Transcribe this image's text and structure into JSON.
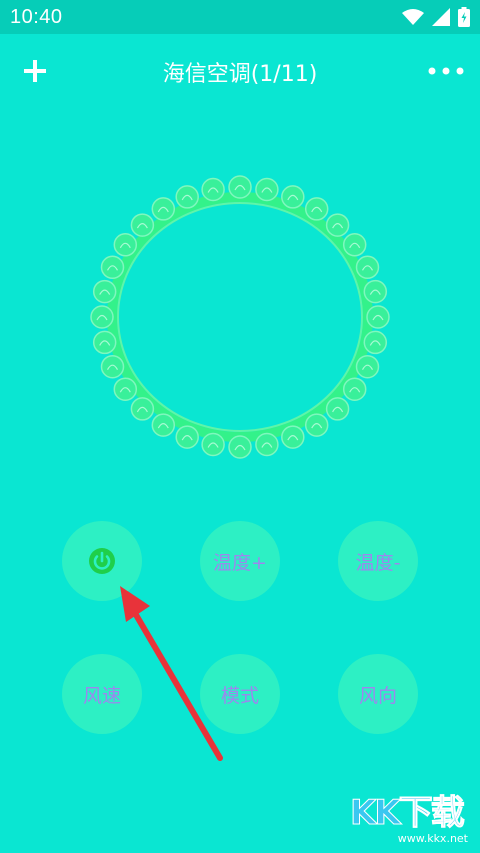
{
  "statusbar": {
    "time": "10:40",
    "icons": [
      "wifi-icon",
      "signal-icon",
      "battery-icon"
    ]
  },
  "appbar": {
    "title": "海信空调(1/11)",
    "add_icon": "plus-icon",
    "more_icon": "more-dots-icon"
  },
  "buttons": {
    "power_icon": "power-icon",
    "temp_up": "温度+",
    "temp_down": "温度-",
    "fan_speed": "风速",
    "mode": "模式",
    "fan_direction": "风向"
  },
  "watermark": {
    "logo_text": "KK下载",
    "url": "www.kkx.net"
  },
  "colors": {
    "background": "#0ae6d2",
    "statusbar": "#06cdb8",
    "button": "#2df0c4",
    "button_text": "#9d86ee",
    "ring": "#33f28a",
    "power": "#1fcf4a",
    "arrow": "#e8333a"
  }
}
